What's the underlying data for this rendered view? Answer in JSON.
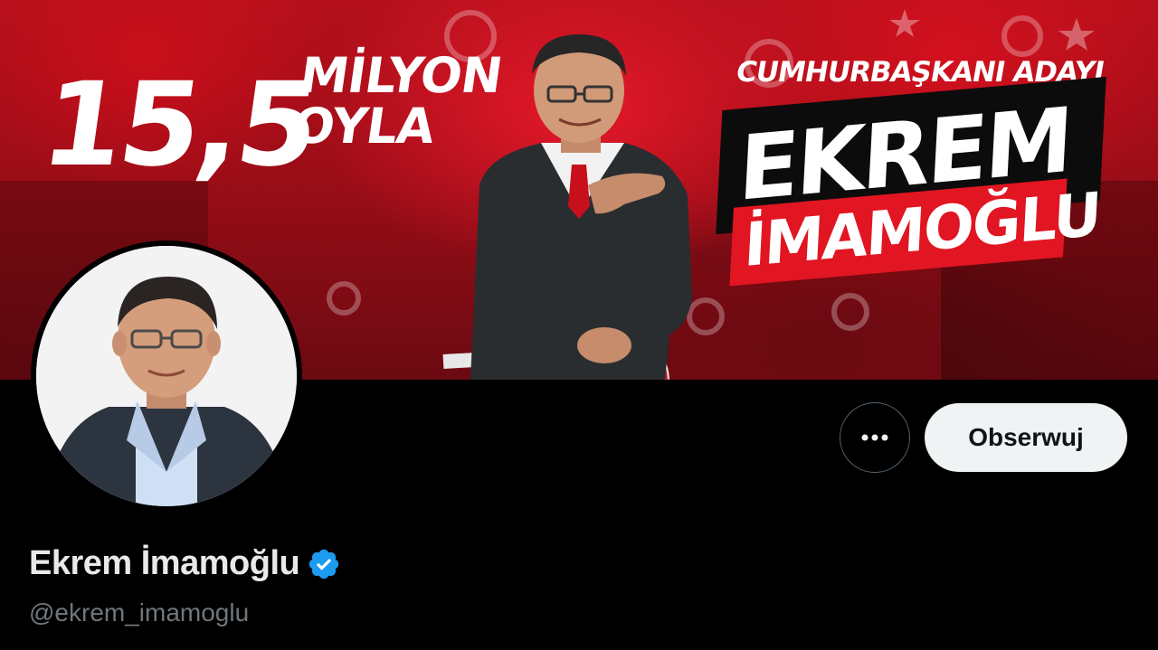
{
  "banner": {
    "headline_number": "15,5",
    "headline_word_1": "MİLYON",
    "headline_word_2": "OYLA",
    "subtitle": "CUMHURBAŞKANI ADAYI",
    "name_first": "EKREM",
    "name_last": "İMAMOĞLU",
    "brand_red": "#e21522"
  },
  "actions": {
    "more_icon": "more-horizontal-icon",
    "follow_label": "Obserwuj"
  },
  "profile": {
    "display_name": "Ekrem İmamoğlu",
    "verified_icon": "verified-badge-icon",
    "verified_color": "#1d9bf0",
    "handle": "@ekrem_imamoglu"
  }
}
